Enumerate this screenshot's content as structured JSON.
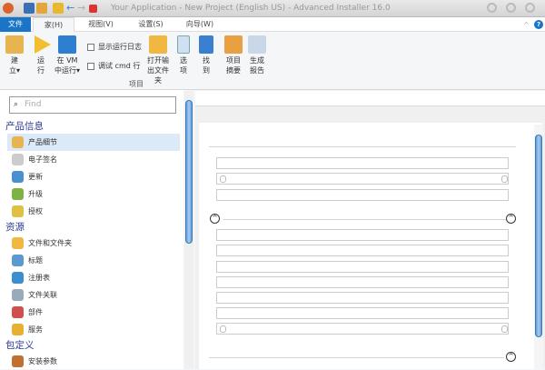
{
  "title": "Your Application - New Project (English US) - Advanced Installer 16.0",
  "tabs": [
    {
      "label": "文件"
    },
    {
      "label": "家(H)"
    },
    {
      "label": "视图(V)"
    },
    {
      "label": "设置(S)"
    },
    {
      "label": "向导(W)"
    }
  ],
  "ribbon": {
    "build": "建立▾",
    "run": "运行",
    "run_vm": "在 VM 中运行▾",
    "show_log": "显示运行日志",
    "debug_cmd": "调试 cmd 行",
    "open_output": "打开输出文件夹",
    "options": "选项",
    "find": "找到",
    "summary": "项目摘要",
    "report": "生成报告",
    "group_label": "项目"
  },
  "help_icon": "?",
  "search": {
    "placeholder": "Find"
  },
  "nav": [
    {
      "header": "产品信息",
      "items": [
        "产品细节",
        "电子签名",
        "更新",
        "升级",
        "授权"
      ]
    },
    {
      "header": "资源",
      "items": [
        "文件和文件夹",
        "标题",
        "注册表",
        "文件关联",
        "部件",
        "服务"
      ]
    },
    {
      "header": "包定义",
      "items": [
        "安装参数"
      ]
    }
  ],
  "colors": {
    "accent": "#1a74c8",
    "header": "#2b3a8f",
    "selected": "#dce9f8"
  }
}
